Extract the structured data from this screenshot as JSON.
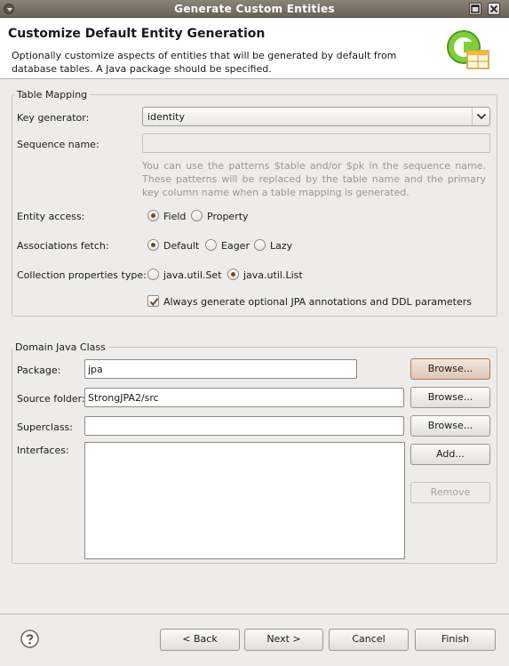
{
  "window": {
    "title": "Generate Custom Entities"
  },
  "header": {
    "title": "Customize Default Entity Generation",
    "description": "Optionally customize aspects of entities that will be generated by default from database tables. A Java package should be specified."
  },
  "table_mapping": {
    "group_label": "Table Mapping",
    "key_generator_label": "Key generator:",
    "key_generator_value": "identity",
    "sequence_name_label": "Sequence name:",
    "sequence_name_value": "",
    "sequence_hint": "You can use the patterns $table and/or $pk in the sequence name. These patterns will be replaced by the table name and the primary key column name when a table mapping is generated.",
    "entity_access_label": "Entity access:",
    "entity_access_options": [
      "Field",
      "Property"
    ],
    "entity_access_selected": "Field",
    "associations_fetch_label": "Associations fetch:",
    "associations_fetch_options": [
      "Default",
      "Eager",
      "Lazy"
    ],
    "associations_fetch_selected": "Default",
    "collection_type_label": "Collection properties type:",
    "collection_type_options": [
      "java.util.Set",
      "java.util.List"
    ],
    "collection_type_selected": "java.util.List",
    "always_generate_label": "Always generate optional JPA annotations and DDL parameters",
    "always_generate_checked": true
  },
  "domain_java_class": {
    "group_label": "Domain Java Class",
    "package_label": "Package:",
    "package_value": "jpa",
    "source_folder_label": "Source folder:",
    "source_folder_value": "StrongJPA2/src",
    "superclass_label": "Superclass:",
    "superclass_value": "",
    "interfaces_label": "Interfaces:",
    "browse_label": "Browse...",
    "add_label": "Add...",
    "remove_label": "Remove"
  },
  "footer": {
    "back_label": "< Back",
    "next_label": "Next >",
    "cancel_label": "Cancel",
    "finish_label": "Finish"
  },
  "icons": {
    "help": "help-icon",
    "logo": "wizard-logo-icon"
  }
}
